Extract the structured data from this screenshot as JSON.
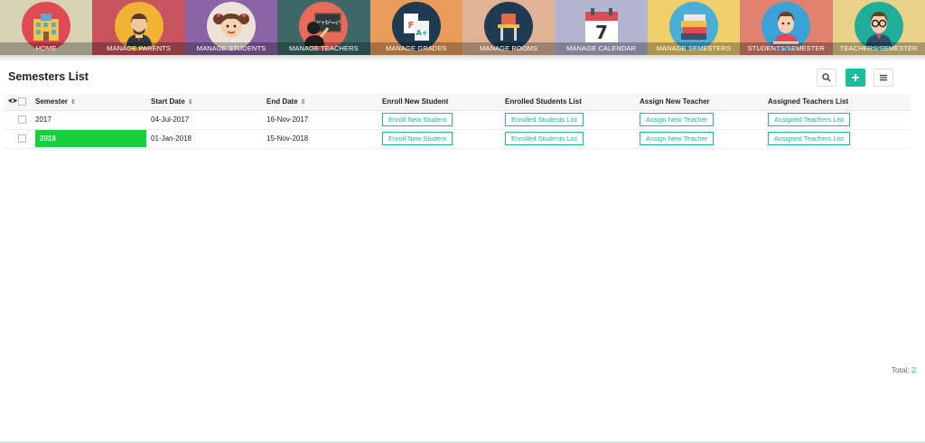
{
  "nav": [
    {
      "label": "HOME",
      "icon": "school-building-icon",
      "bg": "#d8d3b4",
      "circle": "#e04a55"
    },
    {
      "label": "MANAGE PARENTS",
      "icon": "parent-man-icon",
      "bg": "#c8545f",
      "circle": "#f2b233"
    },
    {
      "label": "MANAGE STUDENTS",
      "icon": "student-girl-icon",
      "bg": "#8b64a8",
      "circle": "#ece3d8"
    },
    {
      "label": "MANAGE TEACHERS",
      "icon": "teacher-blackboard-icon",
      "bg": "#3e6868",
      "circle": "#e96a5a"
    },
    {
      "label": "MANAGE GRADES",
      "icon": "grade-papers-icon",
      "bg": "#ea9c5a",
      "circle": "#1f3b54"
    },
    {
      "label": "MANAGE ROOMS",
      "icon": "school-desk-icon",
      "bg": "#e0b296",
      "circle": "#1f3b54"
    },
    {
      "label": "MANAGE CALENDAR",
      "icon": "calendar-icon",
      "bg": "#b3b5d1",
      "circle": "#b3b5d1"
    },
    {
      "label": "MANAGE SEMESTERS",
      "icon": "book-stack-icon",
      "bg": "#f0d06a",
      "circle": "#4aaed6"
    },
    {
      "label": "STUDENTS/SEMESTER",
      "icon": "student-boy-icon",
      "bg": "#e0826e",
      "circle": "#3aa2d8"
    },
    {
      "label": "TEACHERS/SEMESTER",
      "icon": "teacher-glasses-icon",
      "bg": "#ead28a",
      "circle": "#1fae9a"
    }
  ],
  "calendar_day": "7",
  "grade_letters": {
    "f": "F",
    "a": "A+"
  },
  "board_text": "a²+b²=c²",
  "page_title": "Semesters List",
  "columns": {
    "semester": "Semester",
    "start": "Start Date",
    "end": "End Date",
    "enroll": "Enroll New Student",
    "enrolled": "Enrolled Students List",
    "assign": "Assign New Teacher",
    "assigned": "Assigned Teachers List"
  },
  "rows": [
    {
      "semester": "2017",
      "start": "04-Jul-2017",
      "end": "16-Nov-2017",
      "enroll": "Enroll New Student",
      "enrolled": "Enrolled Students List",
      "assign": "Assign New Teacher",
      "assigned": "Assigned Teachers List",
      "highlight": false
    },
    {
      "semester": "2018",
      "start": "01-Jan-2018",
      "end": "15-Nov-2018",
      "enroll": "Enroll New Student",
      "enrolled": "Enrolled Students List",
      "assign": "Assign New Teacher",
      "assigned": "Assigned Teachers List",
      "highlight": true
    }
  ],
  "footer": {
    "total_label": "Total:",
    "total_value": "2"
  },
  "colors": {
    "accent": "#1abc9c",
    "highlight": "#18cf3e"
  }
}
